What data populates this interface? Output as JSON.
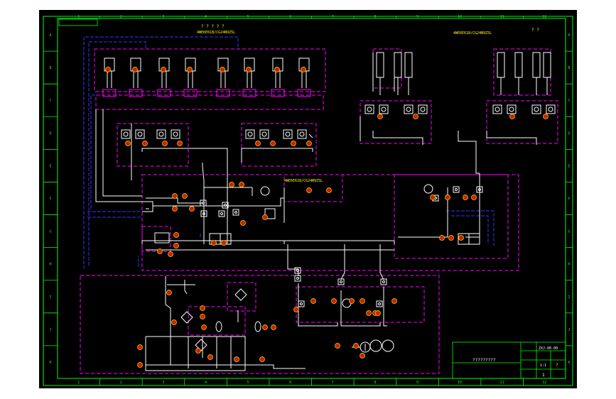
{
  "drawing": {
    "col_numbers": [
      "1",
      "2",
      "3",
      "4",
      "5",
      "6",
      "7",
      "8",
      "9",
      "10",
      "11",
      "12"
    ],
    "row_letters": [
      "A",
      "B",
      "C",
      "D",
      "E",
      "F",
      "G",
      "H",
      "I",
      "J",
      "K"
    ],
    "label_left_top": "? ? ? ? ?",
    "label_left_model": "4WE6E61B/CG24N9Z5L",
    "label_right_top": "? ?",
    "label_right_model": "4WE6E61B/CG24N9Z5L",
    "label_center_model": "4WE6E61B/CG24N9Z5L",
    "title_block": {
      "drawing_title": "?????????",
      "drawing_no": "ZXJ-00-00",
      "scale": "1:1",
      "sheet": "1",
      "mark": "?"
    }
  },
  "colors": {
    "background": "#000000",
    "border": "#00ff00",
    "dashed_group": "#ff00ff",
    "pipe": "#ffffff",
    "pilot_line": "#3333ff",
    "component_text": "#ffff00",
    "marker": "#ff2200"
  },
  "icons": [
    "pump-motor-icon",
    "check-valve-icon",
    "filter-icon",
    "accumulator-icon",
    "solenoid-valve-icon",
    "cylinder-icon"
  ]
}
